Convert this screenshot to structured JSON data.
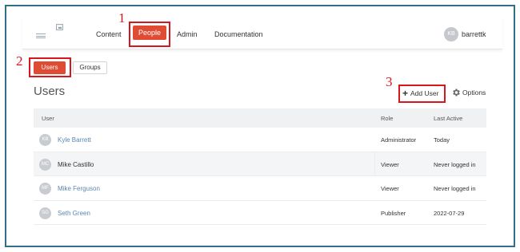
{
  "nav": {
    "items": [
      "Content",
      "People",
      "Admin",
      "Documentation"
    ],
    "user_initials": "KB",
    "user_name": "barrettk"
  },
  "tabs": [
    "Users",
    "Groups"
  ],
  "page_title": "Users",
  "actions": {
    "add_user": "Add User",
    "options": "Options"
  },
  "callouts": [
    "1",
    "2",
    "3"
  ],
  "table": {
    "headers": [
      "User",
      "Role",
      "Last Active"
    ],
    "rows": [
      {
        "initials": "KB",
        "name": "Kyle Barrett",
        "role": "Administrator",
        "last_active": "Today"
      },
      {
        "initials": "MC",
        "name": "Mike Castillo",
        "role": "Viewer",
        "last_active": "Never logged in"
      },
      {
        "initials": "MF",
        "name": "Mike Ferguson",
        "role": "Viewer",
        "last_active": "Never logged in"
      },
      {
        "initials": "SG",
        "name": "Seth Green",
        "role": "Publisher",
        "last_active": "2022-07-29"
      }
    ]
  },
  "colors": {
    "accent": "#e04b33",
    "callout": "#d8161d",
    "frame": "#2f6f8c",
    "link": "#5b87b4"
  }
}
